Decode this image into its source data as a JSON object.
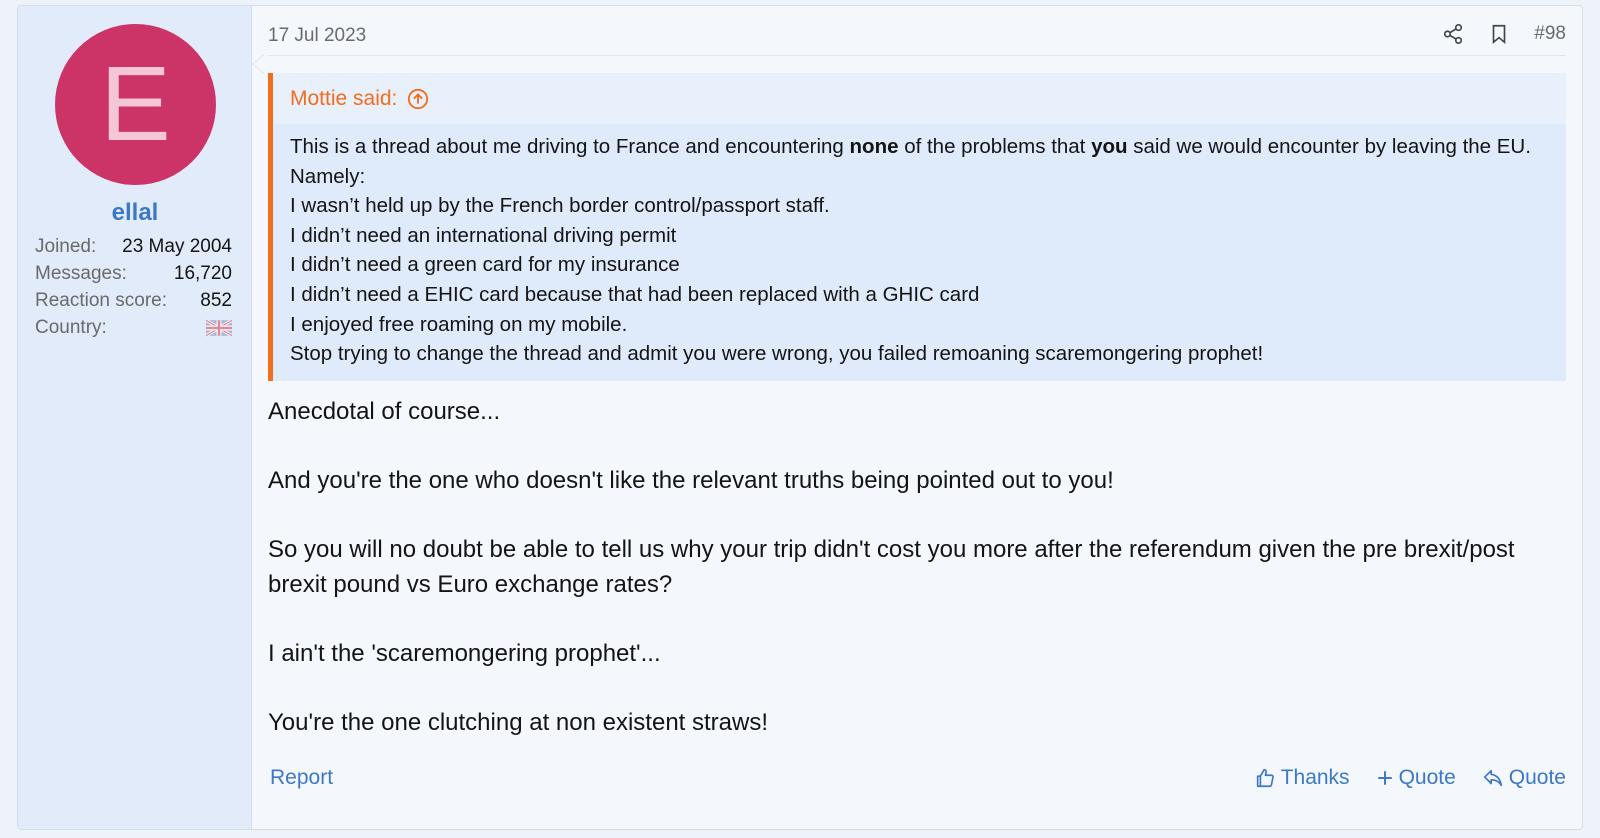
{
  "user": {
    "avatar_letter": "E",
    "avatar_color": "#cc3366",
    "name": "ellal",
    "stats": [
      {
        "label": "Joined:",
        "value": "23 May 2004"
      },
      {
        "label": "Messages:",
        "value": "16,720"
      },
      {
        "label": "Reaction score:",
        "value": "852"
      },
      {
        "label": "Country:",
        "value": ""
      }
    ],
    "country_flag_icon": "uk-flag-icon"
  },
  "post": {
    "date": "17 Jul 2023",
    "number": "#98",
    "share_icon": "share-icon",
    "bookmark_icon": "bookmark-icon"
  },
  "quote": {
    "author_label": "Mottie said:",
    "expand_icon": "arrow-up-circle-icon",
    "line1_a": "This is a thread about me driving to France and encountering ",
    "line1_b": "none",
    "line1_c": " of the problems that ",
    "line1_d": "you",
    "line1_e": " said we would encounter by leaving the EU. Namely:",
    "lines": [
      "I wasn’t held up by the French border control/passport staff.",
      "I didn’t need an international driving permit",
      "I didn’t need a green card for my insurance",
      "I didn’t need a EHIC card because that had been replaced with a GHIC card",
      "I enjoyed free roaming on my mobile.",
      "Stop trying to change the thread and admit you were wrong, you failed remoaning scaremongering prophet!"
    ]
  },
  "body": {
    "paragraphs": [
      "Anecdotal of course...",
      "And you're the one who doesn't like the relevant truths being pointed out to you!",
      "So you will no doubt be able to tell us why your trip didn't cost you more after the referendum given the pre brexit/post brexit pound vs Euro exchange rates?",
      "I ain't the 'scaremongering prophet'...",
      "You're the one clutching at non existent straws!"
    ]
  },
  "footer": {
    "report_label": "Report",
    "thanks_label": "Thanks",
    "multiquote_label": "Quote",
    "reply_label": "Quote"
  },
  "colors": {
    "accent": "#3d78c4",
    "quote_border": "#f26d1d",
    "avatar": "#cc3366"
  }
}
